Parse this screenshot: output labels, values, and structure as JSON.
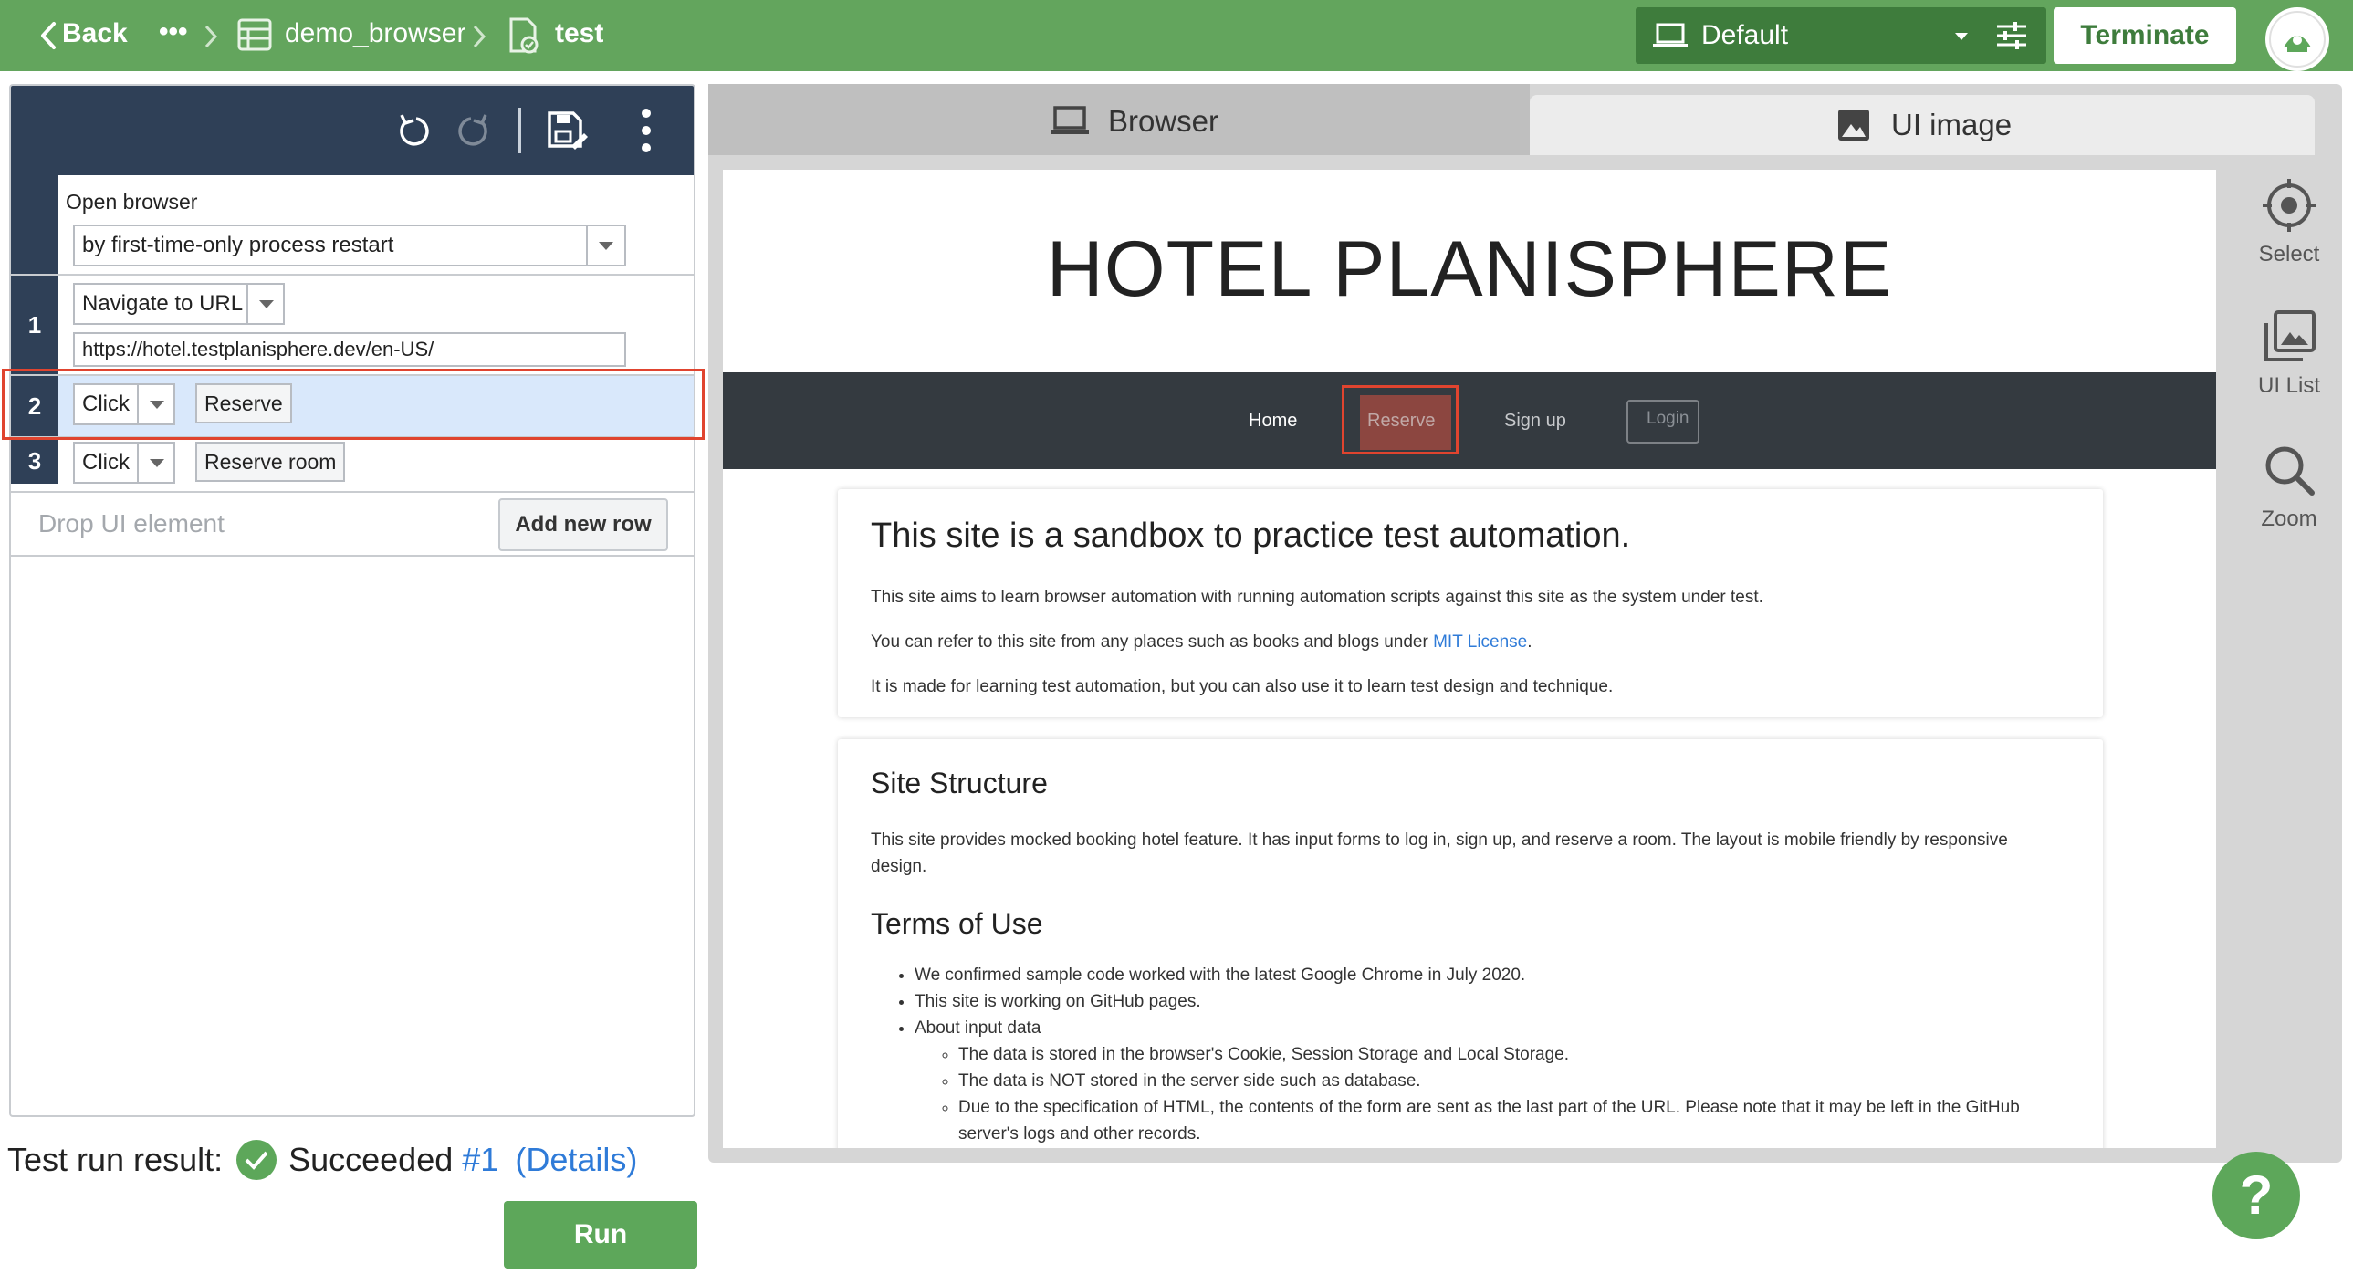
{
  "topbar": {
    "back_label": "Back",
    "ellipsis": "•••",
    "breadcrumb_project": "demo_browser",
    "breadcrumb_test": "test",
    "environment": "Default",
    "terminate_label": "Terminate",
    "colors": {
      "bar": "#63a55d",
      "env_select": "#3e7c3c"
    }
  },
  "steps": [
    {
      "number": "",
      "label": "Open browser",
      "option": "by first-time-only process restart"
    },
    {
      "number": "1",
      "action": "Navigate to URL",
      "url": "https://hotel.testplanisphere.dev/en-US/"
    },
    {
      "number": "2",
      "action": "Click",
      "target": "Reserve",
      "selected": true
    },
    {
      "number": "3",
      "action": "Click",
      "target": "Reserve room"
    }
  ],
  "drop_placeholder": "Drop UI element",
  "add_row_label": "Add new row",
  "result": {
    "label": "Test run result:",
    "status": "Succeeded",
    "run_link": "#1",
    "details_link": "(Details)"
  },
  "run_label": "Run",
  "tabs": [
    {
      "label": "Browser",
      "icon": "laptop-icon",
      "active": false
    },
    {
      "label": "UI image",
      "icon": "image-icon",
      "active": true
    }
  ],
  "side_tools": [
    {
      "label": "Select",
      "icon": "target-icon"
    },
    {
      "label": "UI List",
      "icon": "images-icon"
    },
    {
      "label": "Zoom",
      "icon": "magnifier-icon"
    }
  ],
  "help_label": "?",
  "page": {
    "title": "HOTEL PLANISPHERE",
    "nav": [
      "Home",
      "Reserve",
      "Sign up",
      "Login"
    ],
    "intro_heading": "This site is a sandbox to practice test automation.",
    "intro_p1": "This site aims to learn browser automation with running automation scripts against this site as the system under test.",
    "intro_p2_prefix": "You can refer to this site from any places such as books and blogs under ",
    "intro_p2_link": "MIT License",
    "intro_p2_suffix": ".",
    "intro_p3": "It is made for learning test automation, but you can also use it to learn test design and technique.",
    "structure_heading": "Site Structure",
    "structure_p": "This site provides mocked booking hotel feature. It has input forms to log in, sign up, and reserve a room. The layout is mobile friendly by responsive design.",
    "terms_heading": "Terms of Use",
    "terms_items": [
      "We confirmed sample code worked with the latest Google Chrome in July 2020.",
      "This site is working on GitHub pages.",
      "About input data"
    ],
    "terms_subitems": [
      "The data is stored in the browser's Cookie, Session Storage and Local Storage.",
      "The data is NOT stored in the server side such as database.",
      "Due to the specification of HTML, the contents of the form are sent as the last part of the URL. Please note that it may be left in the GitHub server's logs and other records."
    ]
  }
}
